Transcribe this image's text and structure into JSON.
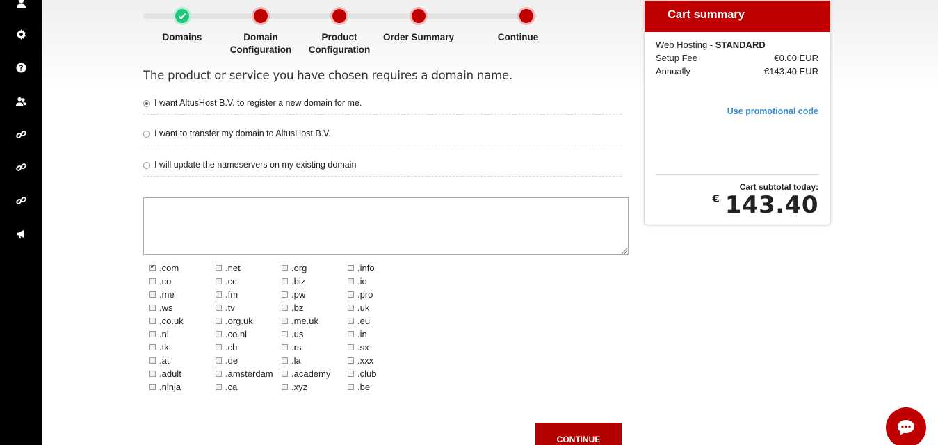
{
  "sidebar": {
    "icons": [
      "user-icon",
      "gear-icon",
      "help-icon",
      "users-icon",
      "link-icon",
      "link-icon",
      "link-icon",
      "megaphone-icon"
    ]
  },
  "stepper": {
    "steps": [
      {
        "label": "Domains",
        "state": "done"
      },
      {
        "label": "Domain Configuration",
        "state": "pending"
      },
      {
        "label": "Product Configuration",
        "state": "pending"
      },
      {
        "label": "Order Summary",
        "state": "pending"
      },
      {
        "label": "Continue",
        "state": "pending"
      }
    ]
  },
  "intro": "The product or service you have chosen requires a domain name.",
  "domain_options": [
    {
      "label": "I want AltusHost B.V. to register a new domain for me.",
      "checked": true
    },
    {
      "label": "I want to transfer my domain to AltusHost B.V.",
      "checked": false
    },
    {
      "label": "I will update the nameservers on my existing domain",
      "checked": false
    }
  ],
  "domain_input": {
    "value": ""
  },
  "tlds": [
    [
      ".com",
      ".net",
      ".org",
      ".info"
    ],
    [
      ".co",
      ".cc",
      ".biz",
      ".io"
    ],
    [
      ".me",
      ".fm",
      ".pw",
      ".pro"
    ],
    [
      ".ws",
      ".tv",
      ".bz",
      ".uk"
    ],
    [
      ".co.uk",
      ".org.uk",
      ".me.uk",
      ".eu"
    ],
    [
      ".nl",
      ".co.nl",
      ".us",
      ".in"
    ],
    [
      ".tk",
      ".ch",
      ".rs",
      ".sx"
    ],
    [
      ".at",
      ".de",
      ".la",
      ".xxx"
    ],
    [
      ".adult",
      ".amsterdam",
      ".academy",
      ".club"
    ],
    [
      ".ninja",
      ".ca",
      ".xyz",
      ".be"
    ]
  ],
  "tlds_checked": [
    ".com"
  ],
  "continue_label": "CONTINUE",
  "cart": {
    "title": "Cart summary",
    "product": "Web Hosting",
    "product_separator": " - ",
    "plan": "STANDARD",
    "lines": [
      {
        "label": "Setup Fee",
        "value": "€0.00 EUR"
      },
      {
        "label": "Annually",
        "value": "€143.40 EUR"
      }
    ],
    "promo_label": "Use promotional code",
    "subtotal_label": "Cart subtotal today:",
    "currency_symbol": "€",
    "subtotal": "143.40"
  },
  "colors": {
    "accent": "#c00000",
    "success": "#1fc77a",
    "link": "#3a8fd0",
    "sidebar": "#000000"
  }
}
